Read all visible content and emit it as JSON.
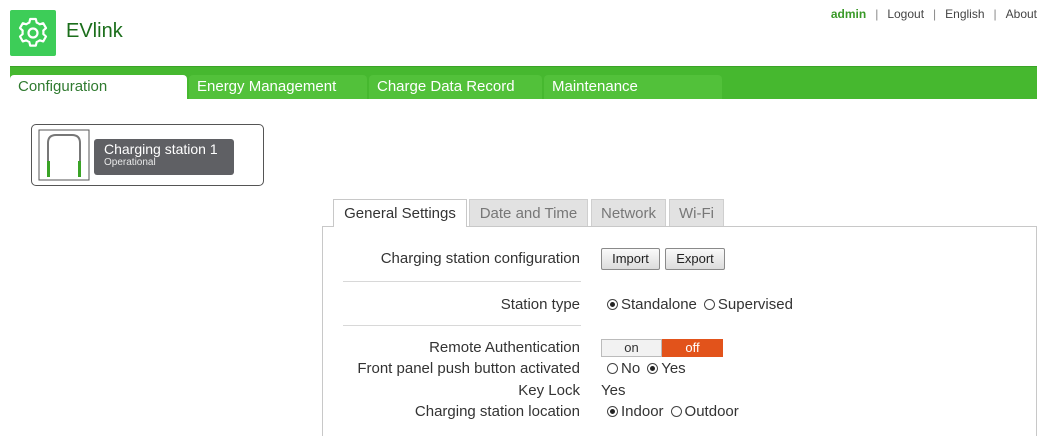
{
  "header": {
    "brand": "EVlink",
    "logo_icon": "gear-icon",
    "user": "admin",
    "links": [
      "Logout",
      "English",
      "About"
    ],
    "separator": "|"
  },
  "main_nav": {
    "tabs": [
      {
        "label": "Configuration",
        "active": true
      },
      {
        "label": "Energy Management",
        "active": false
      },
      {
        "label": "Charge Data Record",
        "active": false
      },
      {
        "label": "Maintenance",
        "active": false
      }
    ]
  },
  "station": {
    "name": "Charging station 1",
    "status": "Operational",
    "icon": "charging-station-icon"
  },
  "sub_tabs": [
    {
      "label": "General Settings",
      "active": true
    },
    {
      "label": "Date and Time",
      "active": false
    },
    {
      "label": "Network",
      "active": false
    },
    {
      "label": "Wi-Fi",
      "active": false
    }
  ],
  "settings": {
    "config_label": "Charging station configuration",
    "import_label": "Import",
    "export_label": "Export",
    "station_type_label": "Station type",
    "station_type_options": [
      "Standalone",
      "Supervised"
    ],
    "station_type_selected": "Standalone",
    "remote_auth_label": "Remote Authentication",
    "remote_auth_on": "on",
    "remote_auth_off": "off",
    "remote_auth_value": "off",
    "front_panel_label": "Front panel push button activated",
    "front_panel_options": [
      "No",
      "Yes"
    ],
    "front_panel_selected": "Yes",
    "key_lock_label": "Key Lock",
    "key_lock_value": "Yes",
    "location_label": "Charging station location",
    "location_options": [
      "Indoor",
      "Outdoor"
    ],
    "location_selected": "Indoor"
  },
  "colors": {
    "brand_green": "#3dcd58",
    "nav_green": "#46b82f",
    "toggle_off": "#e2531b"
  }
}
